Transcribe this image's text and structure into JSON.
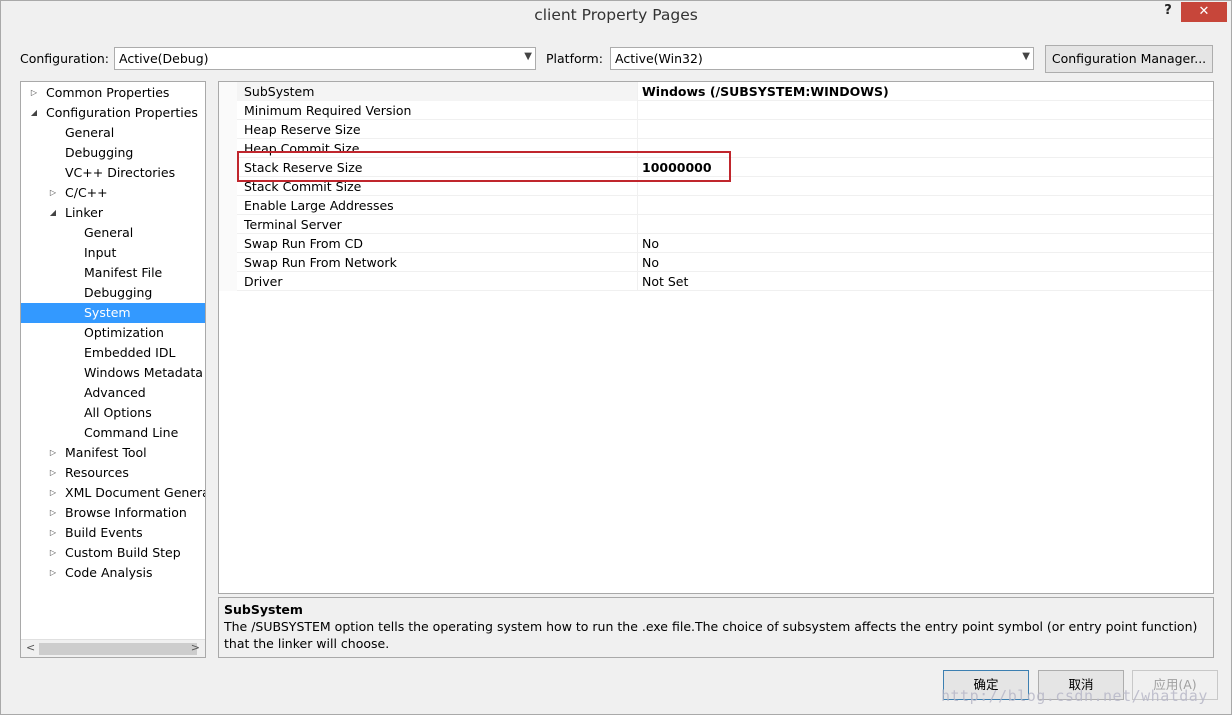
{
  "window": {
    "title": "client Property Pages",
    "help_label": "?",
    "close_label": "✕"
  },
  "toolbar": {
    "configuration_label": "Configuration:",
    "configuration_value": "Active(Debug)",
    "platform_label": "Platform:",
    "platform_value": "Active(Win32)",
    "config_manager_label": "Configuration Manager..."
  },
  "tree": {
    "items": [
      {
        "label": "Common Properties",
        "level": 0,
        "expander": "collapsed"
      },
      {
        "label": "Configuration Properties",
        "level": 0,
        "expander": "expanded"
      },
      {
        "label": "General",
        "level": 1,
        "expander": "none"
      },
      {
        "label": "Debugging",
        "level": 1,
        "expander": "none"
      },
      {
        "label": "VC++ Directories",
        "level": 1,
        "expander": "none"
      },
      {
        "label": "C/C++",
        "level": 1,
        "expander": "collapsed"
      },
      {
        "label": "Linker",
        "level": 1,
        "expander": "expanded"
      },
      {
        "label": "General",
        "level": 2,
        "expander": "none"
      },
      {
        "label": "Input",
        "level": 2,
        "expander": "none"
      },
      {
        "label": "Manifest File",
        "level": 2,
        "expander": "none"
      },
      {
        "label": "Debugging",
        "level": 2,
        "expander": "none"
      },
      {
        "label": "System",
        "level": 2,
        "expander": "none",
        "selected": true
      },
      {
        "label": "Optimization",
        "level": 2,
        "expander": "none"
      },
      {
        "label": "Embedded IDL",
        "level": 2,
        "expander": "none"
      },
      {
        "label": "Windows Metadata",
        "level": 2,
        "expander": "none"
      },
      {
        "label": "Advanced",
        "level": 2,
        "expander": "none"
      },
      {
        "label": "All Options",
        "level": 2,
        "expander": "none"
      },
      {
        "label": "Command Line",
        "level": 2,
        "expander": "none"
      },
      {
        "label": "Manifest Tool",
        "level": 1,
        "expander": "collapsed"
      },
      {
        "label": "Resources",
        "level": 1,
        "expander": "collapsed"
      },
      {
        "label": "XML Document Generat",
        "level": 1,
        "expander": "collapsed"
      },
      {
        "label": "Browse Information",
        "level": 1,
        "expander": "collapsed"
      },
      {
        "label": "Build Events",
        "level": 1,
        "expander": "collapsed"
      },
      {
        "label": "Custom Build Step",
        "level": 1,
        "expander": "collapsed"
      },
      {
        "label": "Code Analysis",
        "level": 1,
        "expander": "collapsed"
      }
    ],
    "scroll_left": "<",
    "scroll_right": ">"
  },
  "properties": [
    {
      "name": "SubSystem",
      "value": "Windows (/SUBSYSTEM:WINDOWS)",
      "bold": true
    },
    {
      "name": "Minimum Required Version",
      "value": "",
      "bold": false
    },
    {
      "name": "Heap Reserve Size",
      "value": "",
      "bold": false
    },
    {
      "name": "Heap Commit Size",
      "value": "",
      "bold": false
    },
    {
      "name": "Stack Reserve Size",
      "value": "10000000",
      "bold": true
    },
    {
      "name": "Stack Commit Size",
      "value": "",
      "bold": false
    },
    {
      "name": "Enable Large Addresses",
      "value": "",
      "bold": false
    },
    {
      "name": "Terminal Server",
      "value": "",
      "bold": false
    },
    {
      "name": "Swap Run From CD",
      "value": "No",
      "bold": false
    },
    {
      "name": "Swap Run From Network",
      "value": "No",
      "bold": false
    },
    {
      "name": "Driver",
      "value": "Not Set",
      "bold": false
    }
  ],
  "description": {
    "title": "SubSystem",
    "text": "The /SUBSYSTEM option tells the operating system how to run the .exe file.The choice of subsystem affects the entry point symbol (or entry point function) that the linker will choose."
  },
  "buttons": {
    "ok": "确定",
    "cancel": "取消",
    "apply": "应用(A)"
  },
  "watermark": "http://blog.csdn.net/whatday",
  "colors": {
    "selection": "#3399ff",
    "highlight_box": "#c0262d",
    "close_button": "#c7463a"
  }
}
